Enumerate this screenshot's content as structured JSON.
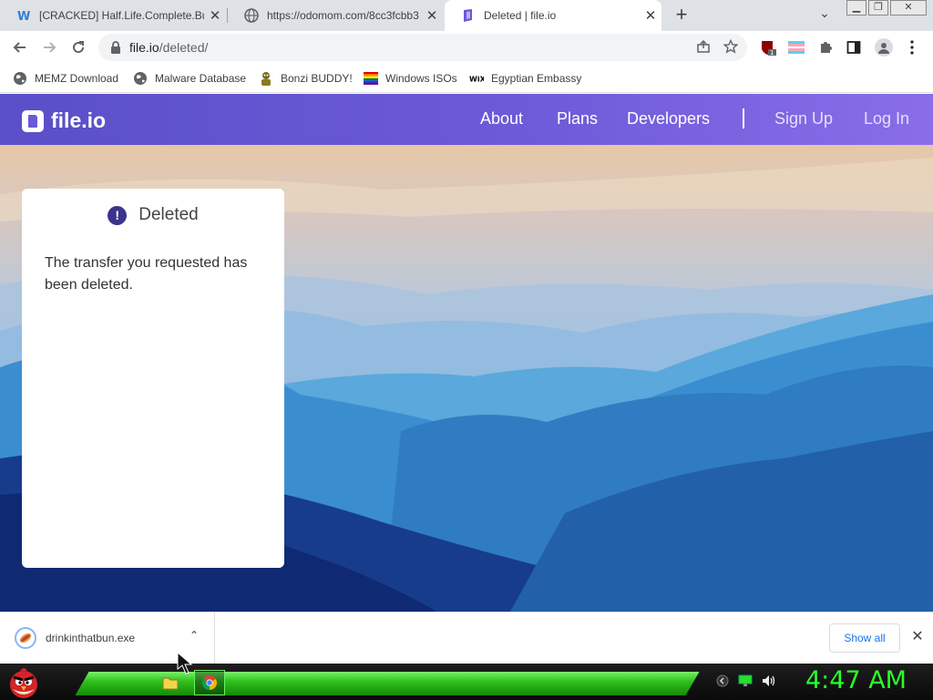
{
  "browser": {
    "tabs": [
      {
        "title": "[CRACKED] Half.Life.Complete.Bu",
        "favicon": "w-logo-icon",
        "active": false
      },
      {
        "title": "https://odomom.com/8cc3fcbb3",
        "favicon": "globe-icon",
        "active": false
      },
      {
        "title": "Deleted | file.io",
        "favicon": "fileio-icon",
        "active": true
      }
    ],
    "address": {
      "host": "file.io",
      "path": "/deleted/"
    },
    "bookmarks": [
      {
        "label": "MEMZ Download",
        "icon": "globe-icon"
      },
      {
        "label": "Malware Database",
        "icon": "globe-icon"
      },
      {
        "label": "Bonzi BUDDY!",
        "icon": "bonzi-icon"
      },
      {
        "label": "Windows ISOs",
        "icon": "windows-flag-icon"
      },
      {
        "label": "Egyptian Embassy",
        "icon": "wix-icon"
      }
    ],
    "extension_badge": "1"
  },
  "site": {
    "logo": "file.io",
    "nav": {
      "about": "About",
      "plans": "Plans",
      "developers": "Developers",
      "signup": "Sign Up",
      "login": "Log In"
    },
    "card": {
      "alert_symbol": "!",
      "heading": "Deleted",
      "message": "The transfer you requested has been deleted."
    },
    "colors": {
      "header_start": "#5a4fc8",
      "header_end": "#8a6de8",
      "alert": "#3b3489"
    }
  },
  "downloads": {
    "file": "drinkinthatbun.exe",
    "show_all": "Show all"
  },
  "taskbar": {
    "clock": "4:47 AM"
  }
}
